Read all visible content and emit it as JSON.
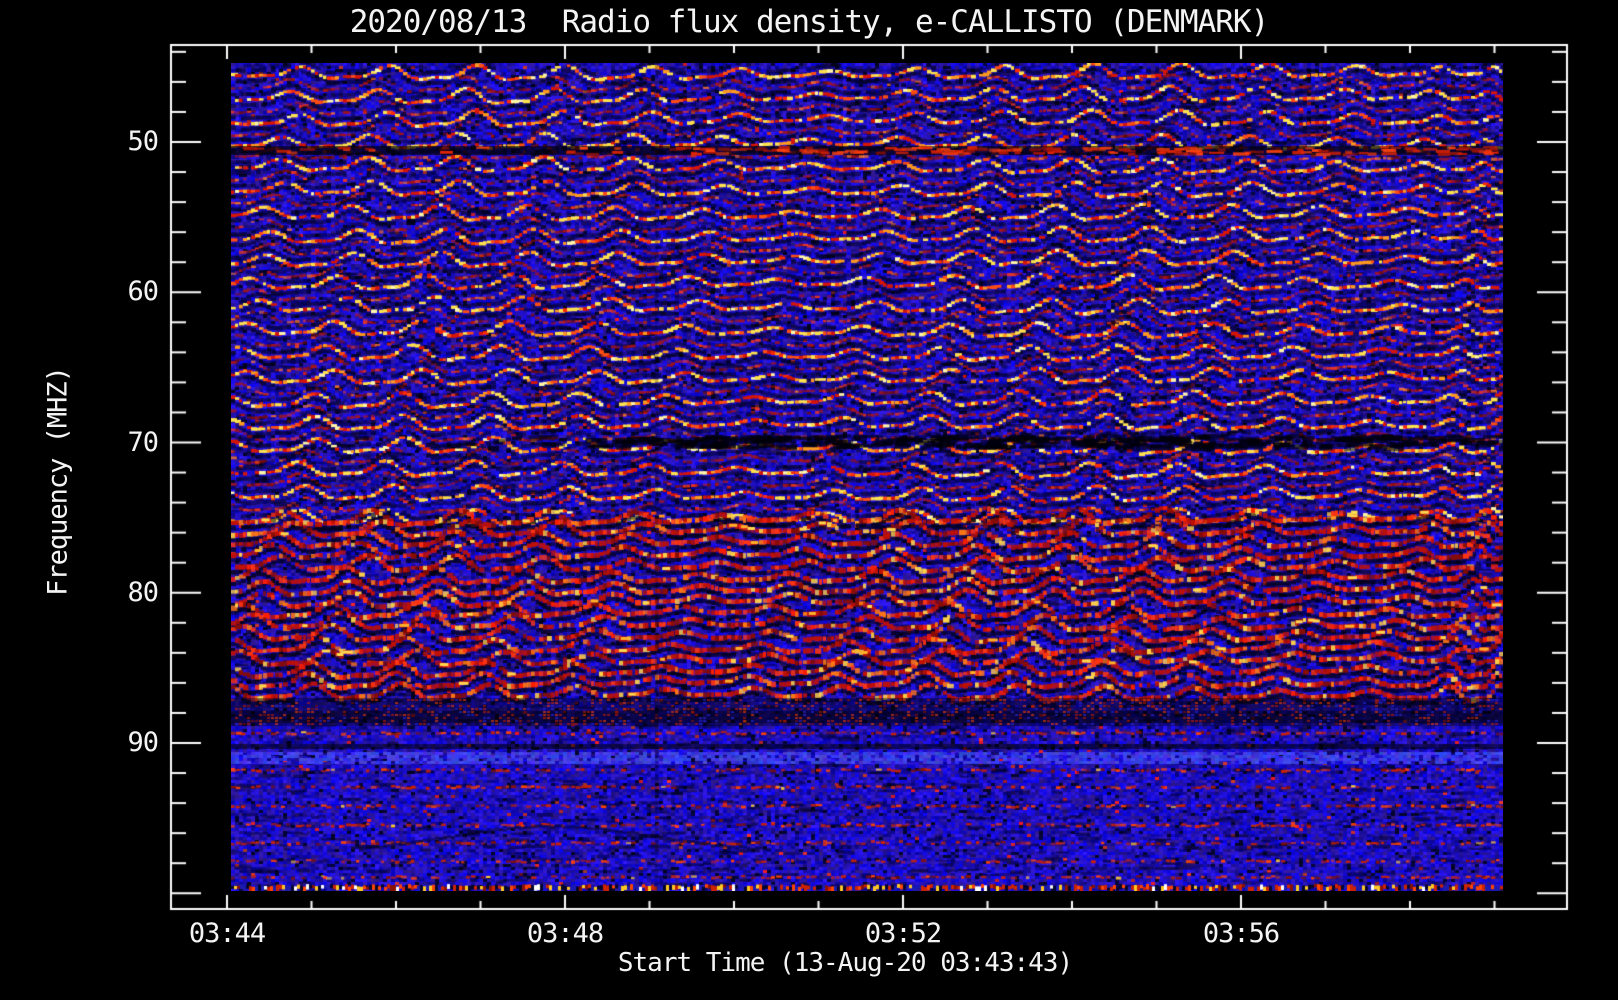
{
  "chart": {
    "title": "2020/08/13  Radio flux density, e-CALLISTO (DENMARK)",
    "x_axis": {
      "label": "Start Time (13-Aug-20 03:43:43)",
      "tick_labels": [
        "03:44",
        "03:48",
        "03:52",
        "03:56"
      ],
      "minor_ticks_per_major_interval": 3,
      "minor_tick_unit": "1 minute"
    },
    "y_axis": {
      "label": "Frequency (MHZ)",
      "tick_labels": [
        "50",
        "60",
        "70",
        "80",
        "90"
      ],
      "minor_tick_step_mhz": 2,
      "direction": "increasing downward"
    }
  },
  "chart_data": {
    "type": "heatmap",
    "subtype": "radio-spectrogram",
    "instrument": "e-CALLISTO",
    "station": "DENMARK",
    "date": "2020/08/13",
    "start_time": "03:43:43",
    "x_tick_times": [
      "03:44",
      "03:48",
      "03:52",
      "03:56"
    ],
    "x_span_minutes_approx": 16,
    "y_major_tick_values_mhz": [
      50,
      60,
      70,
      80,
      90
    ],
    "y_data_range_mhz_approx": [
      45,
      100
    ],
    "colormap": "blue background (low flux) with red-orange-yellow ridges (high flux)",
    "legend": "none",
    "grid": "off",
    "features": [
      {
        "band_mhz": "45-76",
        "description": "regular horizontal carrier stripes (~1.5 MHz spacing) with coherent sinusoidal ionospheric ripple, yellow/orange cores with red fringes on blue noise"
      },
      {
        "band_mhz": "50-51",
        "description": "dark absorption lane with red smear on right half"
      },
      {
        "band_mhz": "70",
        "description": "dark irregular lane, strongest mid-to-right"
      },
      {
        "band_mhz": "76-87",
        "description": "dense intense red rippled band (strong broadcast interference) with black wave troughs and yellow hotspots"
      },
      {
        "band_mhz": "87-89",
        "description": "dark transition band with red speckle"
      },
      {
        "band_mhz": "89-100",
        "description": "mostly uniform blue noise, dark line near 90 MHz, lighter blue lane near 91 MHz, horizontal red speckle rows, bright multicolor speckle row at bottom edge"
      },
      {
        "time_feature": "ripple amplitude modulated in packets along time axis; pattern steepens into diagonal striations near right edge"
      }
    ]
  }
}
